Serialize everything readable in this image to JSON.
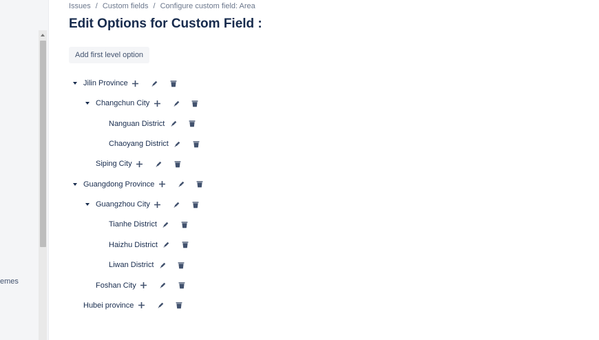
{
  "sidebar": {
    "partial_label": "emes"
  },
  "breadcrumb": [
    "Issues",
    "Custom fields",
    "Configure custom field: Area"
  ],
  "page_title": "Edit Options for Custom Field :",
  "add_first_level_label": "Add first level option",
  "icons": {
    "expand": "caret-down-icon",
    "add": "plus-icon",
    "edit": "pencil-icon",
    "delete": "trash-icon"
  },
  "colors": {
    "text": "#172b4d",
    "icon": "#42526e",
    "button_bg": "#f4f5f7"
  },
  "options": [
    {
      "label": "Jilin Province",
      "level": 1,
      "expanded": true,
      "can_add": true
    },
    {
      "label": "Changchun City",
      "level": 2,
      "expanded": true,
      "can_add": true
    },
    {
      "label": "Nanguan District",
      "level": 3,
      "expanded": false,
      "can_add": false
    },
    {
      "label": "Chaoyang District",
      "level": 3,
      "expanded": false,
      "can_add": false
    },
    {
      "label": "Siping City",
      "level": 2,
      "expanded": false,
      "can_add": true
    },
    {
      "label": "Guangdong Province",
      "level": 1,
      "expanded": true,
      "can_add": true
    },
    {
      "label": "Guangzhou City",
      "level": 2,
      "expanded": true,
      "can_add": true
    },
    {
      "label": "Tianhe District",
      "level": 3,
      "expanded": false,
      "can_add": false
    },
    {
      "label": "Haizhu District",
      "level": 3,
      "expanded": false,
      "can_add": false
    },
    {
      "label": "Liwan District",
      "level": 3,
      "expanded": false,
      "can_add": false
    },
    {
      "label": "Foshan City",
      "level": 2,
      "expanded": false,
      "can_add": true
    },
    {
      "label": "Hubei province",
      "level": 1,
      "expanded": false,
      "can_add": true
    }
  ]
}
